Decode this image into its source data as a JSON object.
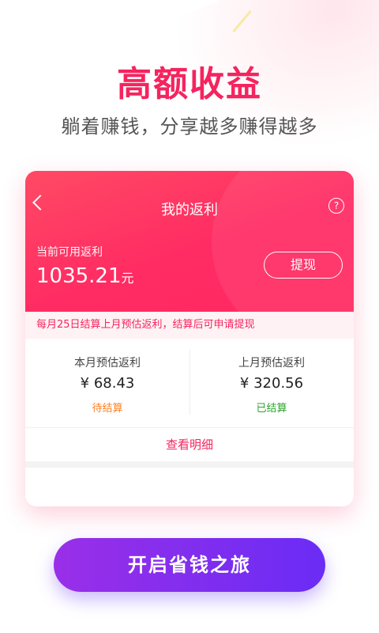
{
  "headline": "高额收益",
  "subline": "躺着赚钱，分享越多赚得越多",
  "card": {
    "title": "我的返利",
    "back_icon": "chevron-left-icon",
    "help_icon": "question-circle-icon",
    "help_glyph": "?",
    "balance_label": "当前可用返利",
    "balance_value": "1035.21",
    "balance_unit": "元",
    "withdraw_label": "提现",
    "notice": "每月25日结算上月预估返利，结算后可申请提现",
    "this_month": {
      "label": "本月预估返利",
      "value": "¥ 68.43",
      "status": "待结算",
      "status_color": "#ff7f1e"
    },
    "last_month": {
      "label": "上月预估返利",
      "value": "¥ 320.56",
      "status": "已结算",
      "status_color": "#2aa32a"
    },
    "detail_link": "查看明细"
  },
  "cta": "开启省钱之旅",
  "colors": {
    "accent": "#f5245e",
    "cta_start": "#9a2fe8",
    "cta_end": "#6a2cf5"
  }
}
